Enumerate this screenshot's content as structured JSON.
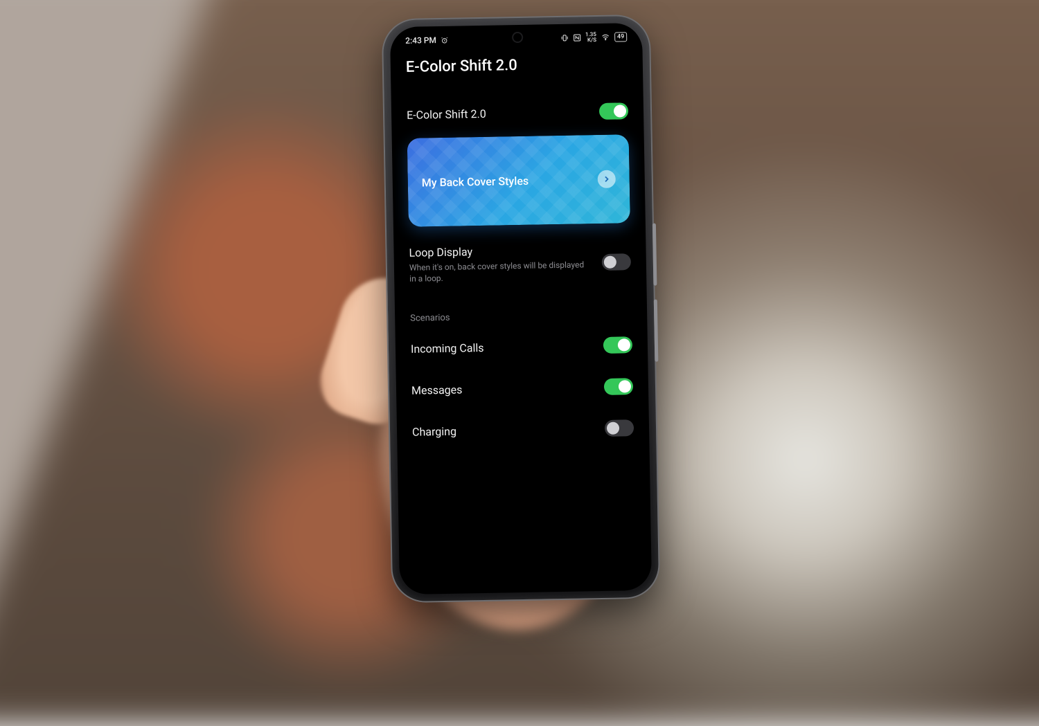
{
  "status": {
    "time": "2:43 PM",
    "battery_level": "49"
  },
  "page": {
    "title": "E-Color Shift 2.0"
  },
  "main_toggle": {
    "label": "E-Color Shift 2.0",
    "on": true
  },
  "card": {
    "label": "My Back Cover Styles"
  },
  "loop_display": {
    "label": "Loop Display",
    "sub": "When it's on, back cover styles will be displayed in a loop.",
    "on": false
  },
  "scenarios": {
    "header": "Scenarios",
    "items": [
      {
        "id": "incoming-calls",
        "label": "Incoming Calls",
        "on": true
      },
      {
        "id": "messages",
        "label": "Messages",
        "on": true
      },
      {
        "id": "charging",
        "label": "Charging",
        "on": false
      }
    ]
  }
}
